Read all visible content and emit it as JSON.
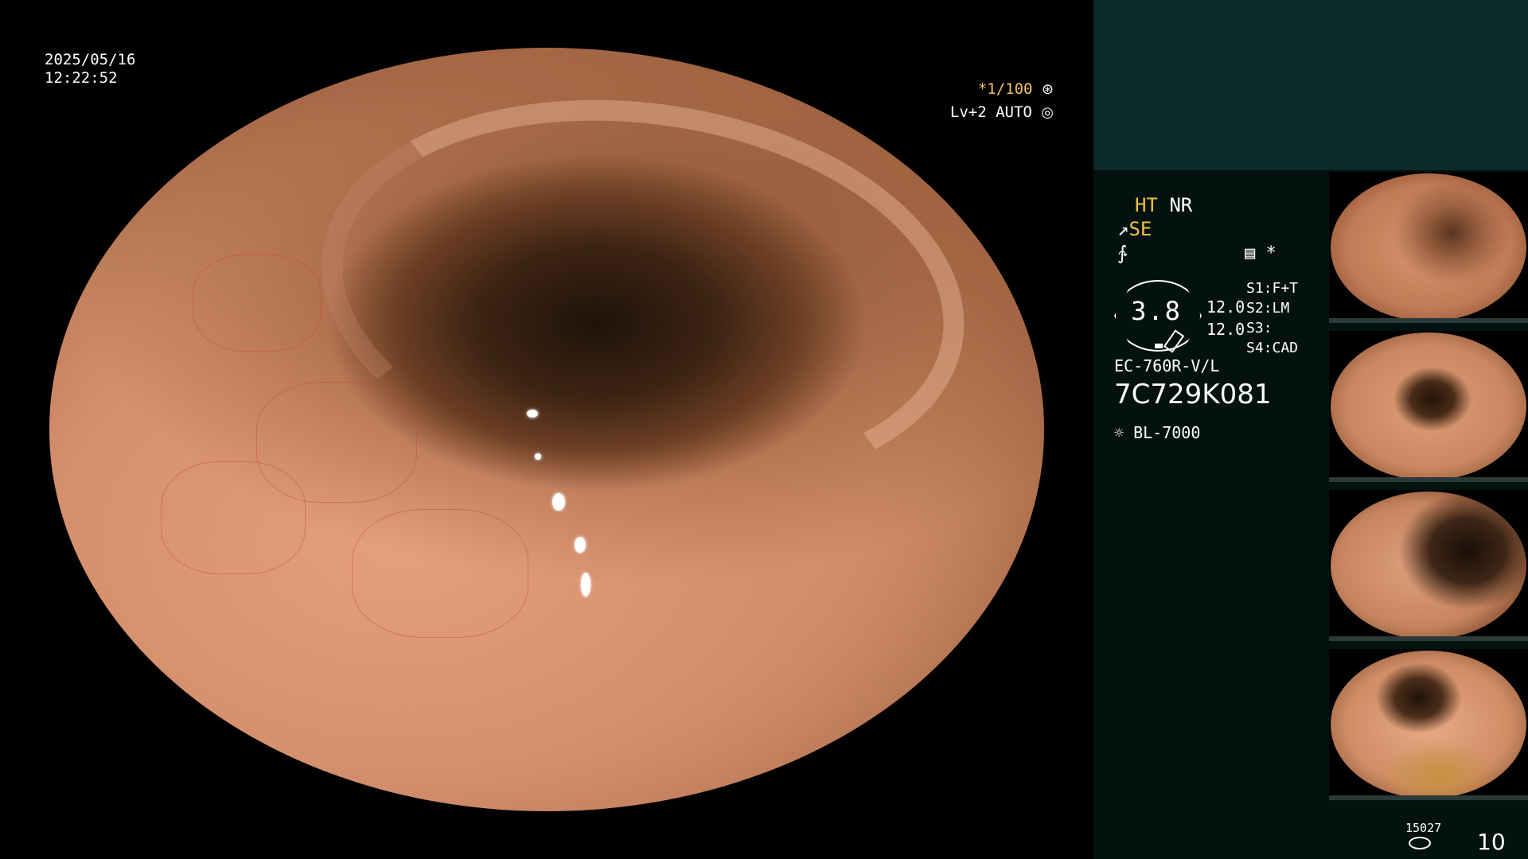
{
  "image_overlay": {
    "date": "2025/05/16",
    "time": "12:22:52",
    "shutter": "*1/100",
    "exposure": "Lv+2 AUTO"
  },
  "side_panel": {
    "ht_label": "HT",
    "nr_label": "NR",
    "se_label": "SE",
    "star": "*",
    "gauge_value": "3.8",
    "value_1": "12.0",
    "value_2": "12.0",
    "s1": "S1:F+T",
    "s2": "S2:LM",
    "s3": "S3:",
    "s4": "S4:CAD",
    "scope_model": "EC-760R-V/L",
    "scope_serial": "7C729K081",
    "light_source": "BL-7000"
  },
  "footer": {
    "record_count": "15027",
    "image_count": "10"
  },
  "icons": [
    "shutter-icon",
    "iris-icon",
    "enhance-icon",
    "list-icon",
    "light-source-icon",
    "disk-icon"
  ]
}
